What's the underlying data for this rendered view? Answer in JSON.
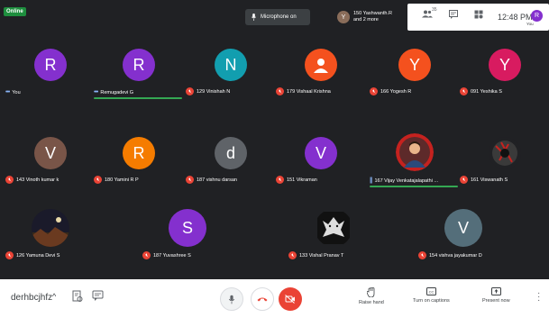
{
  "status": {
    "online": "Online"
  },
  "mic_pill": {
    "label": "Microphone on"
  },
  "presenter": {
    "avatar": "Y",
    "line1": "150 Yashwanth.R",
    "line2": "and 2 more"
  },
  "header": {
    "time": "12:48 PM",
    "you_label": "You",
    "avatar_letter": "R",
    "badge_count": "35"
  },
  "participants": [
    {
      "initial": "R",
      "color": "#8430ce",
      "label": "You",
      "muted": false,
      "dots": true
    },
    {
      "initial": "R",
      "color": "#8430ce",
      "label": "Remugadevi G",
      "muted": false,
      "dots": true,
      "speaking": true
    },
    {
      "initial": "N",
      "color": "#129eaf",
      "label": "129 Vinishah N",
      "muted": true
    },
    {
      "initial": "",
      "color": "#f4511e",
      "label": "179 Vishaal Krishna",
      "muted": true,
      "person": true
    },
    {
      "initial": "Y",
      "color": "#f4511e",
      "label": "166 Yogesh R",
      "muted": true
    },
    {
      "initial": "Y",
      "color": "#d81b60",
      "label": "091 Yeshika S",
      "muted": true
    },
    {
      "initial": "V",
      "color": "#795548",
      "label": "143 Vinoth kumar k",
      "muted": true
    },
    {
      "initial": "R",
      "color": "#f57c00",
      "label": "180 Yamini R P",
      "muted": true
    },
    {
      "initial": "d",
      "color": "#5f6368",
      "label": "187 vishnu darsan",
      "muted": true
    },
    {
      "initial": "V",
      "color": "#8430ce",
      "label": "151 Vikraman",
      "muted": true
    },
    {
      "initial": "",
      "color": "#c5221f",
      "label": "167 Vijay Venkatajalapathi ...",
      "muted": false,
      "dots": true,
      "speaking": true,
      "photo": "boy"
    },
    {
      "initial": "",
      "color": "#3c4043",
      "label": "161 Viswanath S",
      "muted": true,
      "photo": "dark"
    },
    {
      "initial": "",
      "color": "#2d2d2d",
      "label": "126 Yamuna Devi S",
      "muted": true,
      "photo": "night"
    },
    {
      "initial": "S",
      "color": "#8430ce",
      "label": "187 Yuvashree S",
      "muted": true
    },
    {
      "initial": "",
      "color": "#111",
      "label": "133 Vishal Pranav T",
      "muted": true,
      "photo": "wolf"
    },
    {
      "initial": "V",
      "color": "#546e7a",
      "label": "154 vishva jayakumar D",
      "muted": true
    }
  ],
  "bottom": {
    "meeting_code": "derhbcjhfz",
    "raise_hand": "Raise hand",
    "captions": "Turn on captions",
    "present": "Present now"
  }
}
